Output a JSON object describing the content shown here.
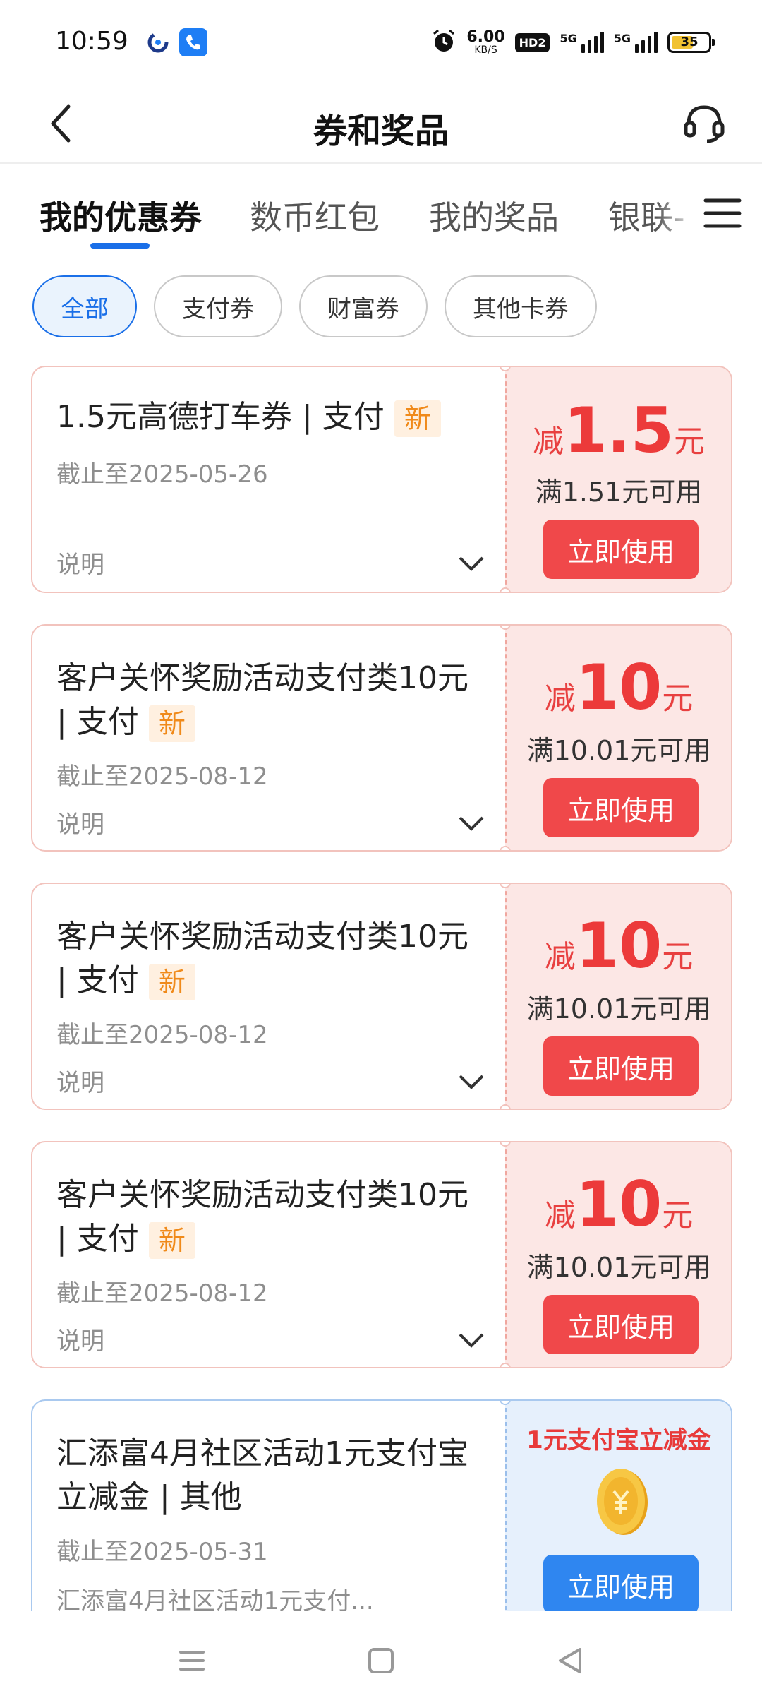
{
  "status_bar": {
    "time": "10:59",
    "net_speed_value": "6.00",
    "net_speed_unit": "KB/S",
    "hd_badge": "HD2",
    "signal1_label": "5G",
    "signal2_label": "5G",
    "battery": "35"
  },
  "header": {
    "title": "券和奖品"
  },
  "tabs": [
    {
      "label": "我的优惠券"
    },
    {
      "label": "数币红包"
    },
    {
      "label": "我的奖品"
    },
    {
      "label": "银联-"
    }
  ],
  "filters": [
    {
      "label": "全部"
    },
    {
      "label": "支付券"
    },
    {
      "label": "财富券"
    },
    {
      "label": "其他卡券"
    }
  ],
  "coupons": [
    {
      "title": "1.5元高德打车券 | 支付",
      "tag": "新",
      "date": "截止至2025-05-26",
      "desc": "说明",
      "prefix": "减",
      "amount": "1.5",
      "unit": "元",
      "condition": "满1.51元可用",
      "button": "立即使用"
    },
    {
      "title": "客户关怀奖励活动支付类10元 | 支付",
      "tag": "新",
      "date": "截止至2025-08-12",
      "desc": "说明",
      "prefix": "减",
      "amount": "10",
      "unit": "元",
      "condition": "满10.01元可用",
      "button": "立即使用"
    },
    {
      "title": "客户关怀奖励活动支付类10元 | 支付",
      "tag": "新",
      "date": "截止至2025-08-12",
      "desc": "说明",
      "prefix": "减",
      "amount": "10",
      "unit": "元",
      "condition": "满10.01元可用",
      "button": "立即使用"
    },
    {
      "title": "客户关怀奖励活动支付类10元 | 支付",
      "tag": "新",
      "date": "截止至2025-08-12",
      "desc": "说明",
      "prefix": "减",
      "amount": "10",
      "unit": "元",
      "condition": "满10.01元可用",
      "button": "立即使用"
    },
    {
      "title": "汇添富4月社区活动1元支付宝立减金 | 其他",
      "date": "截止至2025-05-31",
      "desc": "汇添富4月社区活动1元支付...",
      "promo_title": "1元支付宝立减金",
      "button": "立即使用"
    }
  ],
  "colors": {
    "accent_blue": "#1a6fe8",
    "coupon_red": "#f0484a",
    "coupon_bg": "#fce7e5",
    "new_tag": "#f08a1a"
  }
}
